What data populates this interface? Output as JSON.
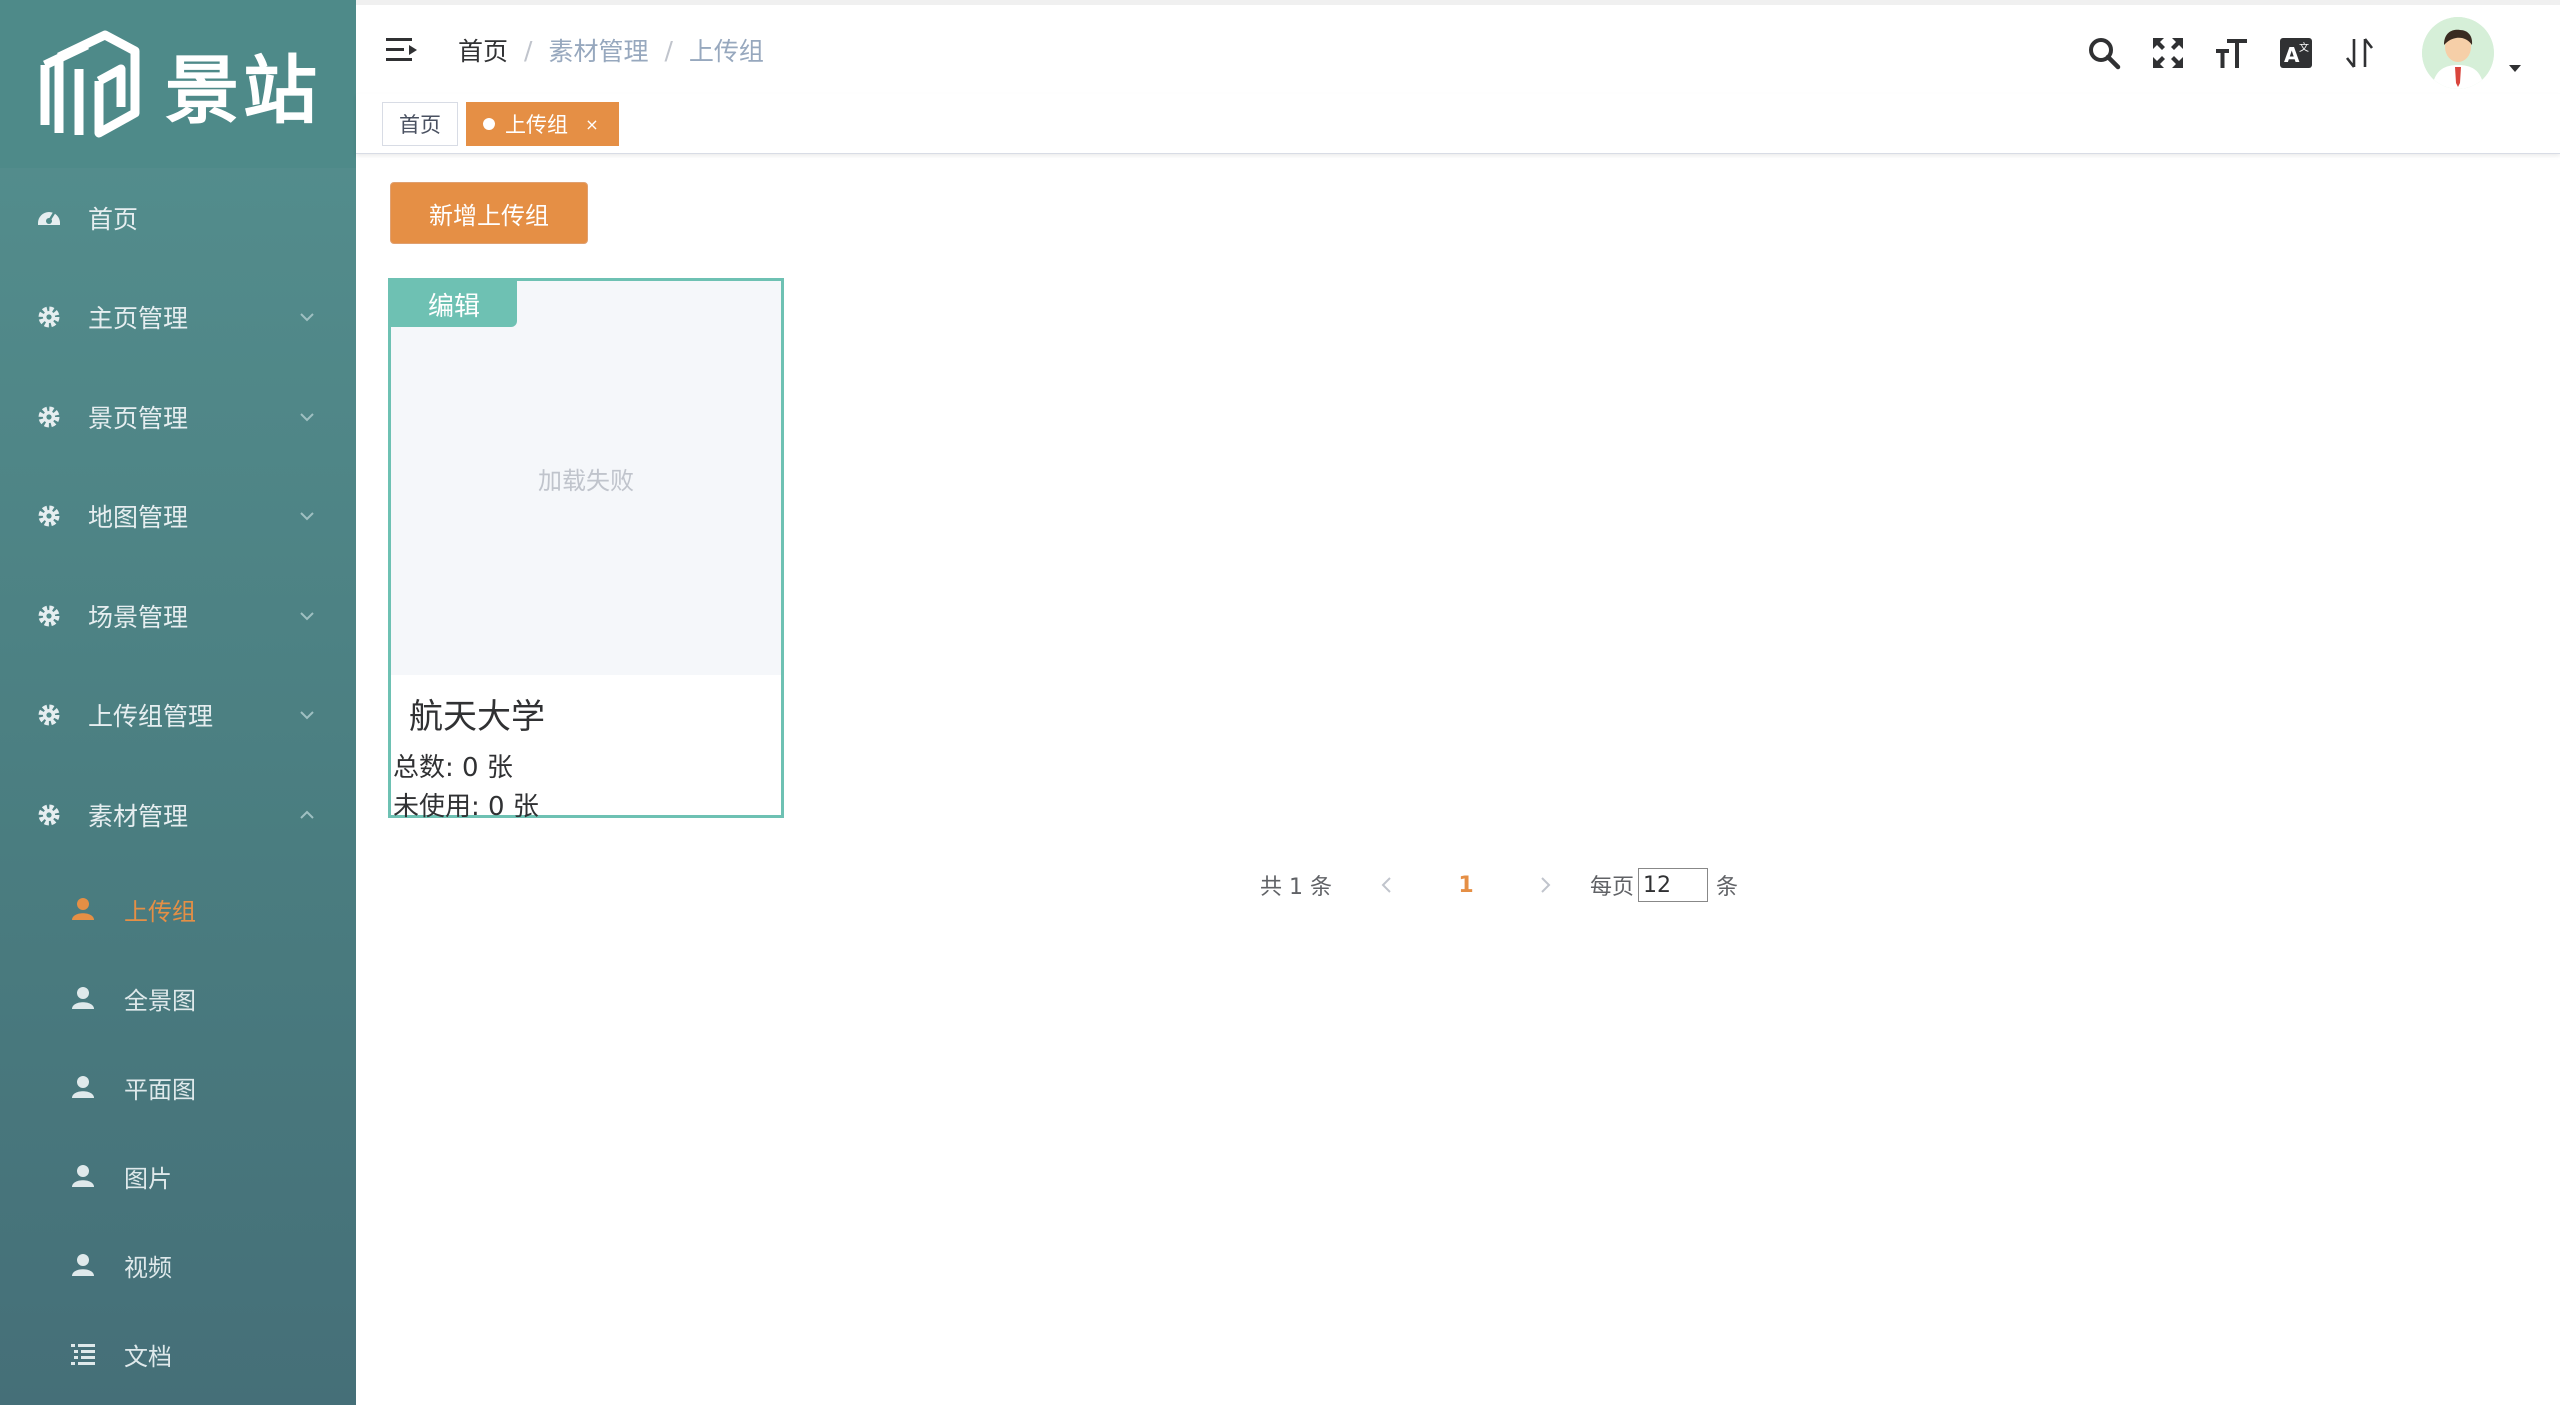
{
  "app": {
    "logo_text": "景站"
  },
  "sidebar": {
    "items": [
      {
        "label": "首页",
        "icon": "dashboard-icon",
        "expandable": false
      },
      {
        "label": "主页管理",
        "icon": "gear-icon",
        "expandable": true
      },
      {
        "label": "景页管理",
        "icon": "gear-icon",
        "expandable": true
      },
      {
        "label": "地图管理",
        "icon": "gear-icon",
        "expandable": true
      },
      {
        "label": "场景管理",
        "icon": "gear-icon",
        "expandable": true
      },
      {
        "label": "上传组管理",
        "icon": "gear-icon",
        "expandable": true
      },
      {
        "label": "素材管理",
        "icon": "gear-icon",
        "expandable": true,
        "expanded": true
      }
    ],
    "sub_items": [
      {
        "label": "上传组",
        "icon": "user-icon",
        "active": true
      },
      {
        "label": "全景图",
        "icon": "user-icon"
      },
      {
        "label": "平面图",
        "icon": "user-icon"
      },
      {
        "label": "图片",
        "icon": "user-icon"
      },
      {
        "label": "视频",
        "icon": "user-icon"
      },
      {
        "label": "文档",
        "icon": "list-icon"
      }
    ]
  },
  "header": {
    "breadcrumb": [
      "首页",
      "素材管理",
      "上传组"
    ],
    "tools": [
      "search-icon",
      "fullscreen-icon",
      "font-size-icon",
      "translate-icon",
      "sort-icon"
    ]
  },
  "tags": {
    "home": "首页",
    "active": "上传组",
    "close": "×"
  },
  "main": {
    "add_button": "新增上传组",
    "cards": [
      {
        "edit_label": "编辑",
        "image_placeholder": "加载失败",
        "title": "航天大学",
        "total": "总数: 0 张",
        "unused": "未使用: 0 张"
      }
    ]
  },
  "pagination": {
    "total": "共 1 条",
    "current": "1",
    "per_page_label": "每页",
    "per_page_value": "12",
    "unit": "条"
  },
  "colors": {
    "sidebar": "#4e8a89",
    "accent": "#e58f45",
    "card_border": "#6ec1b3"
  }
}
